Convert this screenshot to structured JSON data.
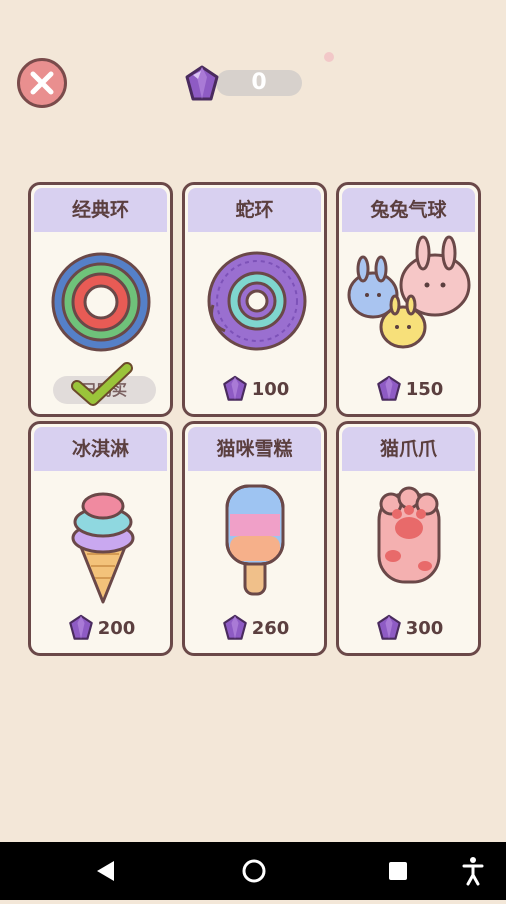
{
  "header": {
    "gem_count": "0"
  },
  "items": [
    {
      "name": "经典环",
      "status": "已购买",
      "selected": true
    },
    {
      "name": "蛇环",
      "price": "100"
    },
    {
      "name": "兔兔气球",
      "price": "150"
    },
    {
      "name": "冰淇淋",
      "price": "200"
    },
    {
      "name": "猫咪雪糕",
      "price": "260"
    },
    {
      "name": "猫爪爪",
      "price": "300"
    }
  ],
  "colors": {
    "background": "#f3e7d8",
    "card_header": "#d8d0f0",
    "gem": "#8e5bc4",
    "close_button": "#e98f8f",
    "check": "#9ac43a"
  },
  "icons": {
    "close": "close-icon",
    "gem": "gem-icon",
    "check": "check-icon",
    "nav_back": "back-triangle-icon",
    "nav_home": "home-circle-icon",
    "nav_recents": "recents-square-icon",
    "nav_accessibility": "accessibility-icon"
  }
}
